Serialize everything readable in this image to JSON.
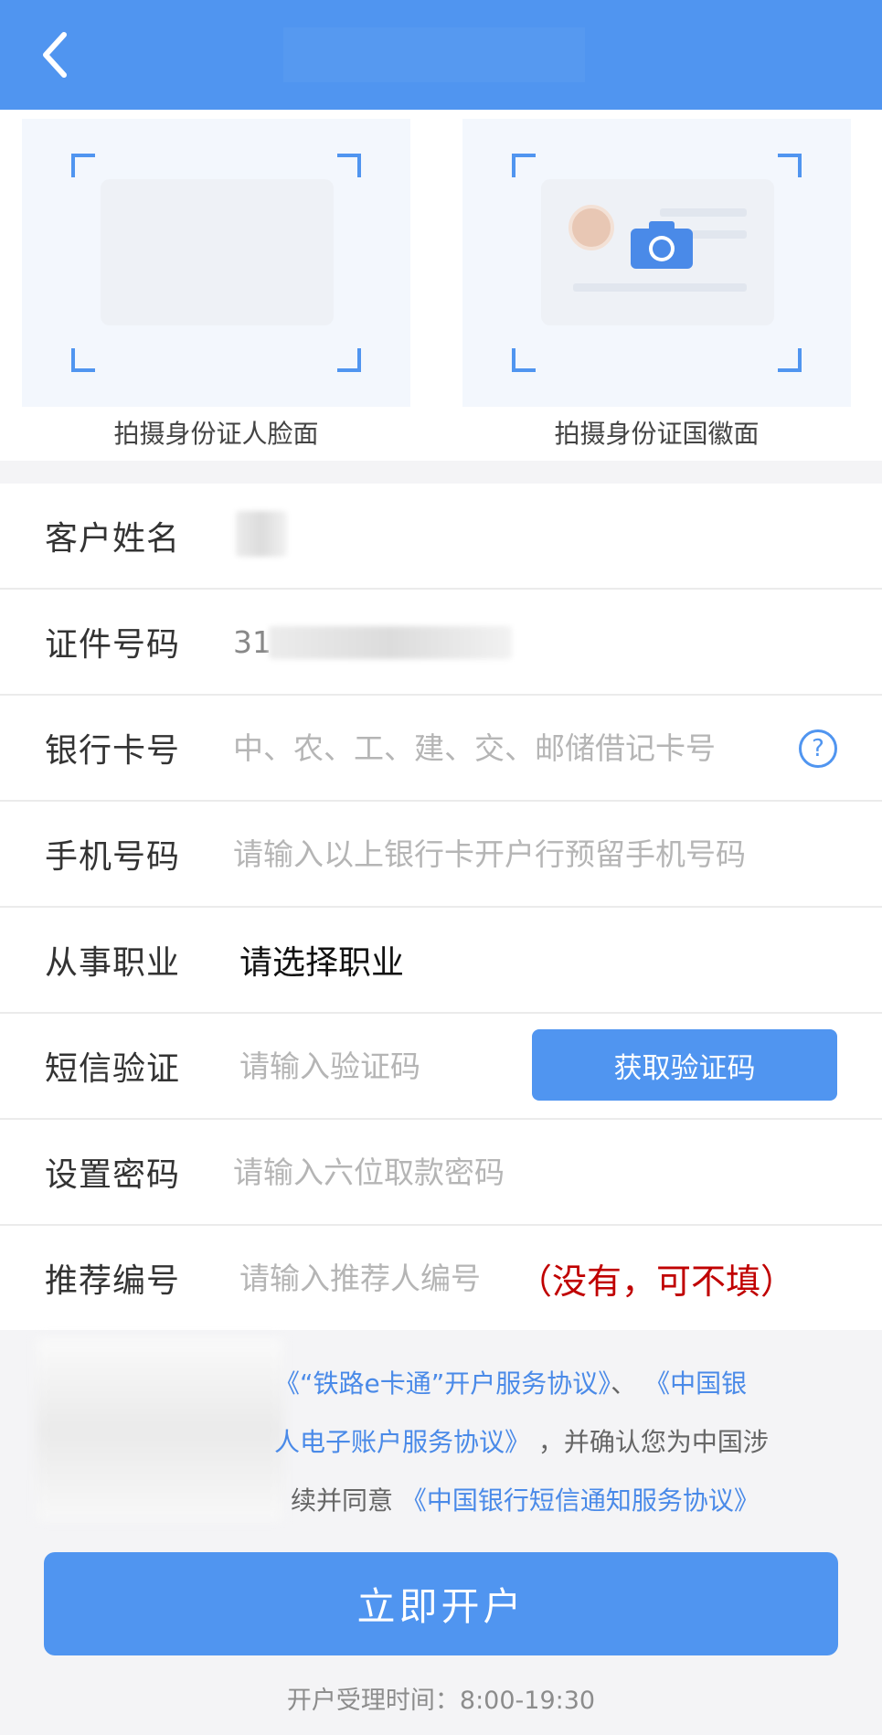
{
  "header": {
    "back_icon": "chevron-left-icon",
    "bg_color": "#5095f0"
  },
  "photo_upload": {
    "front_label": "拍摄身份证人脸面",
    "back_label": "拍摄身份证国徽面"
  },
  "form": {
    "name": {
      "label": "客户姓名"
    },
    "id_number": {
      "label": "证件号码",
      "value_prefix": "31"
    },
    "bank_card": {
      "label": "银行卡号",
      "placeholder": "中、农、工、建、交、邮储借记卡号",
      "help_icon": "?"
    },
    "phone": {
      "label": "手机号码",
      "placeholder": "请输入以上银行卡开户行预留手机号码"
    },
    "occupation": {
      "label": "从事职业",
      "value": "请选择职业"
    },
    "sms": {
      "label": "短信验证",
      "placeholder": "请输入验证码",
      "button": "获取验证码"
    },
    "password": {
      "label": "设置密码",
      "placeholder": "请输入六位取款密码"
    },
    "referrer": {
      "label": "推荐编号",
      "placeholder": "请输入推荐人编号",
      "note": "（没有，可不填）"
    }
  },
  "agreement": {
    "link1": "《“铁路e卡通”开户服务协议》",
    "sep": "、",
    "link2_part1": "《中国银",
    "link2_part2": "人电子账户服务协议》",
    "text1": "，并确认您为中国涉",
    "text2": "续并同意",
    "link3": "《中国银行短信通知服务协议》"
  },
  "submit": {
    "label": "立即开户"
  },
  "footer": {
    "hours": "开户受理时间：8:00-19:30"
  },
  "colors": {
    "accent": "#5095f0",
    "note": "#c00000",
    "link": "#4a8ae8"
  }
}
